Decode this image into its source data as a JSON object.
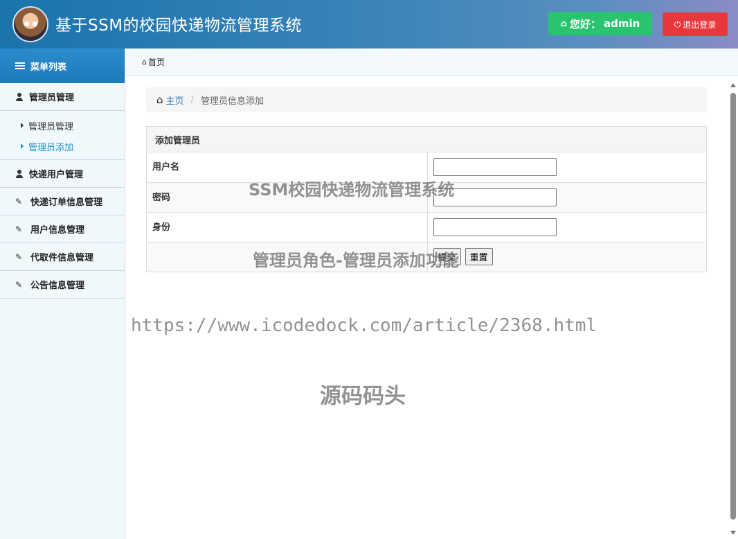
{
  "header": {
    "title": "基于SSM的校园快递物流管理系统",
    "greeting_prefix": "您好：",
    "username": "admin",
    "logout_label": "退出登录",
    "colors": {
      "greet": "#29c46f",
      "logout": "#e8383d",
      "header_start": "#1b73ac"
    }
  },
  "sidebar": {
    "menu_title": "菜单列表",
    "groups": [
      {
        "label": "管理员管理",
        "icon": "user-icon"
      },
      {
        "label": "快递用户管理",
        "icon": "user-icon"
      },
      {
        "label": "快递订单信息管理",
        "icon": "edit-icon"
      },
      {
        "label": "用户信息管理",
        "icon": "edit-icon"
      },
      {
        "label": "代取件信息管理",
        "icon": "edit-icon"
      },
      {
        "label": "公告信息管理",
        "icon": "edit-icon"
      }
    ],
    "subitems": [
      {
        "label": "管理员管理"
      },
      {
        "label": "管理员添加"
      }
    ]
  },
  "topbar": {
    "home": "首页"
  },
  "breadcrumb": {
    "home": "主页",
    "current": "管理员信息添加"
  },
  "form": {
    "title": "添加管理员",
    "fields": [
      {
        "label": "用户名",
        "value": ""
      },
      {
        "label": "密码",
        "value": ""
      },
      {
        "label": "身份",
        "value": ""
      }
    ],
    "submit_label": "提交",
    "reset_label": "重置"
  },
  "watermarks": {
    "w1": "SSM校园快递物流管理系统",
    "w2": "管理员角色-管理员添加功能",
    "w3": "https://www.icodedock.com/article/2368.html",
    "w4": "源码码头"
  }
}
